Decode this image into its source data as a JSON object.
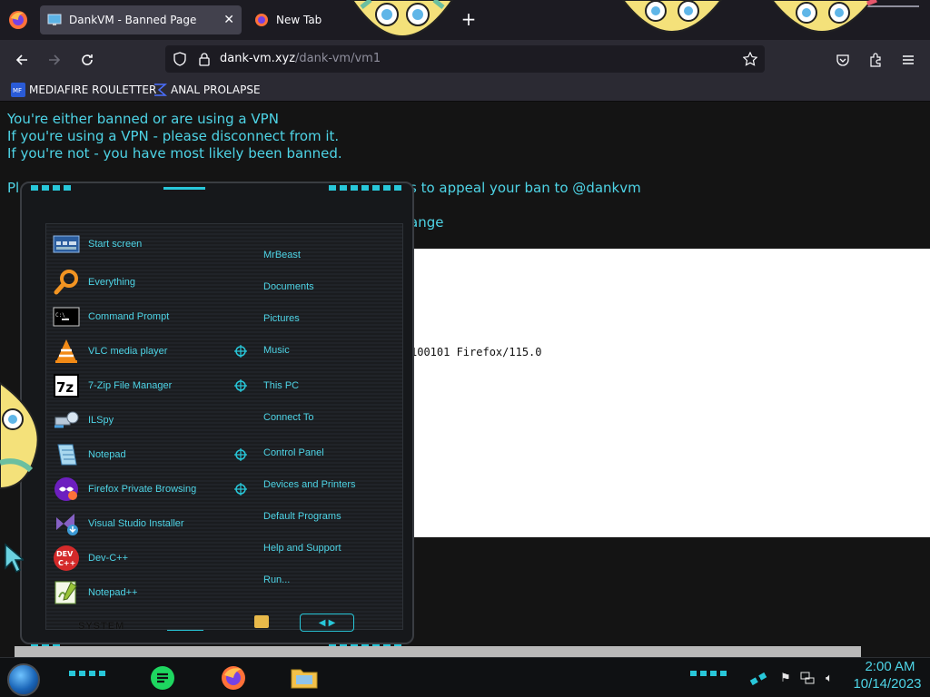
{
  "browser": {
    "tabs": [
      {
        "title": "DankVM - Banned Page",
        "active": true
      },
      {
        "title": "New Tab",
        "active": false
      }
    ],
    "url": {
      "host": "dank-vm.xyz",
      "path": "/dank-vm/vm1"
    },
    "bookmarks": [
      {
        "label": "MEDIAFIRE ROULETTER",
        "icon": "mediafire-icon"
      },
      {
        "label": "ANAL PROLAPSE",
        "icon": "sigma-icon"
      }
    ]
  },
  "page": {
    "lines": [
      "You're either banned or are using a VPN",
      "If you're using a VPN - please disconnect from it.",
      "If you're not - you have most likely been banned.",
      "s to appeal your ban to @dankvm",
      "ange"
    ],
    "prefix": "Pl",
    "user_agent": "100101 Firefox/115.0"
  },
  "start_menu": {
    "apps": [
      {
        "label": "Start screen",
        "icon": "start-screen-icon",
        "arrow": false
      },
      {
        "label": "Everything",
        "icon": "magnifier-icon",
        "arrow": false
      },
      {
        "label": "Command Prompt",
        "icon": "cmd-icon",
        "arrow": false
      },
      {
        "label": "VLC media player",
        "icon": "vlc-icon",
        "arrow": true
      },
      {
        "label": "7-Zip File Manager",
        "icon": "7zip-icon",
        "arrow": true
      },
      {
        "label": "ILSpy",
        "icon": "ilspy-icon",
        "arrow": false
      },
      {
        "label": "Notepad",
        "icon": "notepad-icon",
        "arrow": true
      },
      {
        "label": "Firefox Private Browsing",
        "icon": "firefox-private-icon",
        "arrow": true
      },
      {
        "label": "Visual Studio Installer",
        "icon": "vs-installer-icon",
        "arrow": false
      },
      {
        "label": "Dev-C++",
        "icon": "devcpp-icon",
        "arrow": false
      },
      {
        "label": "Notepad++",
        "icon": "notepadpp-icon",
        "arrow": false
      }
    ],
    "links": [
      "MrBeast",
      "Documents",
      "Pictures",
      "Music",
      "This PC",
      "Connect To",
      "Control Panel",
      "Devices and Printers",
      "Default Programs",
      "Help and Support",
      "Run..."
    ],
    "system_label": "SYSTEM"
  },
  "taskbar": {
    "apps": [
      "notes-icon",
      "firefox-icon",
      "file-explorer-icon"
    ],
    "clock": {
      "time": "2:00 AM",
      "date": "10/14/2023"
    }
  },
  "colors": {
    "accent": "#28c7d9",
    "text_cyan": "#4ed4e6",
    "page_bg": "#141414"
  }
}
